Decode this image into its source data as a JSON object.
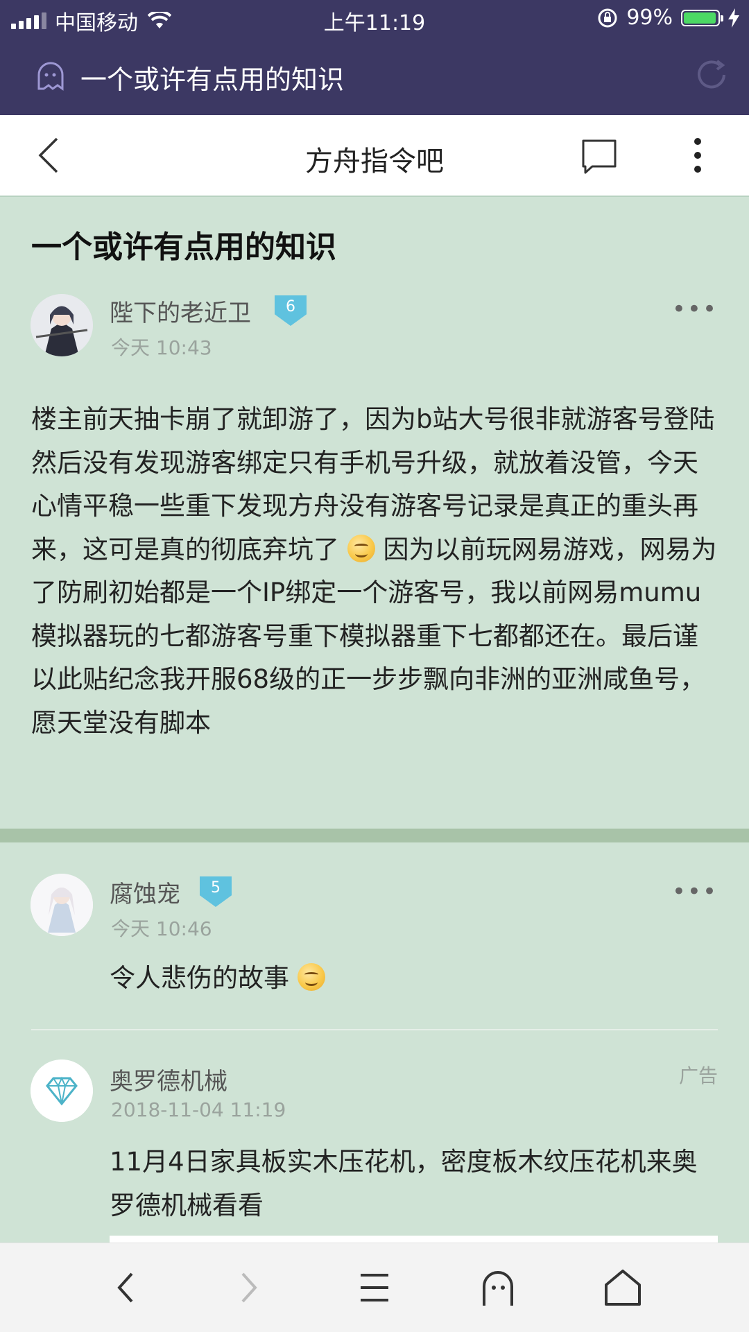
{
  "status_bar": {
    "carrier": "中国移动",
    "time": "上午11:19",
    "battery": "99%"
  },
  "app_bar": {
    "title": "一个或许有点用的知识"
  },
  "nav_bar": {
    "title": "方舟指令吧"
  },
  "post": {
    "title": "一个或许有点用的知识",
    "author": "陛下的老近卫",
    "level": "6",
    "time": "今天 10:43",
    "body_part1": "楼主前天抽卡崩了就卸游了，因为b站大号很非就游客号登陆然后没有发现游客绑定只有手机号升级，就放着没管，今天心情平稳一些重下发现方舟没有游客号记录是真正的重头再来，这可是真的彻底弃坑了",
    "body_part2": "因为以前玩网易游戏，网易为了防刷初始都是一个IP绑定一个游客号，我以前网易mumu模拟器玩的七都游客号重下模拟器重下七都都还在。最后谨以此贴纪念我开服68级的正一步步飘向非洲的亚洲咸鱼号，愿天堂没有脚本"
  },
  "reply": {
    "author": "腐蚀宠",
    "level": "5",
    "time": "今天 10:46",
    "text": "令人悲伤的故事"
  },
  "ad": {
    "author": "奥罗德机械",
    "tag": "广告",
    "time": "2018-11-04 11:19",
    "text": "11月4日家具板实木压花机，密度板木纹压花机来奥罗德机械看看"
  }
}
